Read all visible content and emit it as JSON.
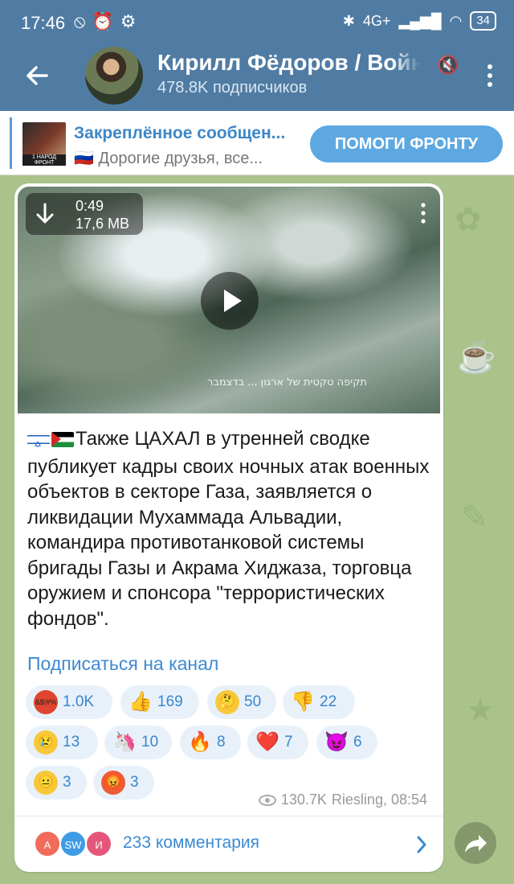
{
  "status_bar": {
    "time": "17:46",
    "battery": "34",
    "network": "4G+"
  },
  "header": {
    "title": "Кирилл Фёдоров / Война",
    "subtitle": "478.8K подписчиков"
  },
  "pinned": {
    "title": "Закреплённое сообщен...",
    "text": "🇷🇺 Дорогие друзья, все...",
    "thumb_text": "1 НАРОД ФРОНТ",
    "button": "ПОМОГИ ФРОНТУ"
  },
  "message": {
    "video": {
      "duration": "0:49",
      "size": "17,6 MB",
      "caption": "תקיפה טקטית של ארגון ... בדצמבר"
    },
    "text": "Также ЦАХАЛ в утренней сводке публикует кадры своих ночных атак военных объектов в секторе Газа, заявляется о ликвидации Мухаммада Альвадии, командира противотанковой системы бригады Газы и Акрама Хиджаза, торговца оружием и спонсора \"террористических фондов\".",
    "subscribe_link": "Подписаться на канал",
    "reactions": [
      {
        "emoji": "&$!#%",
        "icon": "angry-cursing-icon",
        "count": "1.0K"
      },
      {
        "emoji": "👍",
        "icon": "thumbs-up-icon",
        "count": "169"
      },
      {
        "emoji": "🤔",
        "icon": "thinking-face-icon",
        "count": "50"
      },
      {
        "emoji": "👎",
        "icon": "thumbs-down-icon",
        "count": "22"
      },
      {
        "emoji": "😢",
        "icon": "crying-face-icon",
        "count": "13"
      },
      {
        "emoji": "🦄",
        "icon": "unicorn-icon",
        "count": "10"
      },
      {
        "emoji": "🔥",
        "icon": "fire-icon",
        "count": "8"
      },
      {
        "emoji": "❤️",
        "icon": "heart-icon",
        "count": "7"
      },
      {
        "emoji": "😈",
        "icon": "devil-icon",
        "count": "6"
      },
      {
        "emoji": "😐",
        "icon": "neutral-face-icon",
        "count": "3"
      },
      {
        "emoji": "😡",
        "icon": "angry-face-icon",
        "count": "3"
      }
    ],
    "views": "130.7K",
    "author_time": "Riesling, 08:54",
    "comments": {
      "avatars": [
        "А",
        "SW",
        "И"
      ],
      "label": "233 комментария"
    }
  },
  "colors": {
    "header": "#507ca3",
    "accent": "#3c8ad2",
    "button": "#5ea8e2",
    "background": "#a9c38b"
  }
}
